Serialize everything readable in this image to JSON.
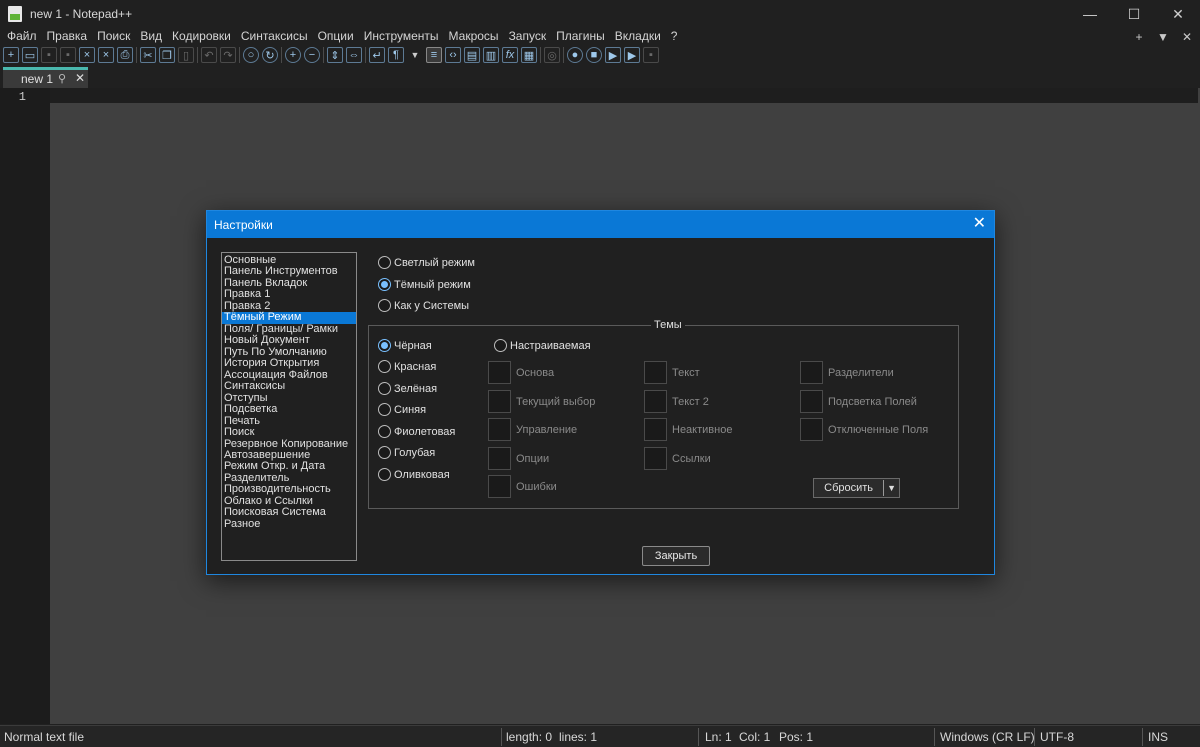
{
  "window": {
    "title": "new 1 - Notepad++",
    "controls": [
      "—",
      "☐",
      "✕"
    ]
  },
  "menu": {
    "items": [
      "Файл",
      "Правка",
      "Поиск",
      "Вид",
      "Кодировки",
      "Синтаксисы",
      "Опции",
      "Инструменты",
      "Макросы",
      "Запуск",
      "Плагины",
      "Вкладки",
      "?"
    ],
    "right": [
      "+",
      "▼",
      "✕"
    ]
  },
  "toolbar": {
    "icons": [
      "new-file-icon",
      "open-file-icon",
      "save-icon",
      "save-all-icon",
      "close-icon",
      "close-all-icon",
      "print-icon",
      "cut-icon",
      "copy-icon",
      "paste-icon",
      "undo-icon",
      "redo-icon",
      "find-icon",
      "replace-icon",
      "zoom-in-icon",
      "zoom-out-icon",
      "sync-vertical-icon",
      "sync-horizontal-icon",
      "word-wrap-icon",
      "show-all-chars-icon",
      "dropdown-icon",
      "indent-guide-icon",
      "language-icon",
      "doc-map-icon",
      "doc-list-icon",
      "function-list-icon",
      "folder-workspace-icon",
      "monitoring-icon",
      "record-macro-icon",
      "stop-macro-icon",
      "play-macro-icon",
      "run-macro-multiple-icon",
      "save-macro-icon"
    ]
  },
  "tab": {
    "label": "new 1"
  },
  "editor": {
    "line_number": "1"
  },
  "status": {
    "file_type": "Normal text file",
    "length": "length: 0",
    "lines": "lines: 1",
    "ln": "Ln: 1",
    "col": "Col: 1",
    "pos": "Pos: 1",
    "eol": "Windows (CR LF)",
    "encoding": "UTF-8",
    "mode": "INS"
  },
  "dialog": {
    "title": "Настройки",
    "categories": [
      "Основные",
      "Панель Инструментов",
      "Панель Вкладок",
      "Правка 1",
      "Правка 2",
      "Тёмный Режим",
      "Поля/ Границы/ Рамки",
      "Новый Документ",
      "Путь По Умолчанию",
      "История Открытия",
      "Ассоциация Файлов",
      "Синтаксисы",
      "Отступы",
      "Подсветка",
      "Печать",
      "Поиск",
      "Резервное Копирование",
      "Автозавершение",
      "Режим Откр. и Дата",
      "Разделитель",
      "Производительность",
      "Облако и Ссылки",
      "Поисковая Система",
      "Разное"
    ],
    "selected_category": "Тёмный Режим",
    "modes": [
      {
        "label": "Светлый режим",
        "checked": false
      },
      {
        "label": "Тёмный режим",
        "checked": true
      },
      {
        "label": "Как у Системы",
        "checked": false
      }
    ],
    "themes_label": "Темы",
    "themes": [
      {
        "label": "Чёрная",
        "checked": true
      },
      {
        "label": "Красная",
        "checked": false
      },
      {
        "label": "Зелёная",
        "checked": false
      },
      {
        "label": "Синяя",
        "checked": false
      },
      {
        "label": "Фиолетовая",
        "checked": false
      },
      {
        "label": "Голубая",
        "checked": false
      },
      {
        "label": "Оливковая",
        "checked": false
      }
    ],
    "custom_label": "Настраиваемая",
    "color_col1": [
      "Основа",
      "Текущий выбор",
      "Управление",
      "Опции",
      "Ошибки"
    ],
    "color_col2": [
      "Текст",
      "Текст 2",
      "Неактивное",
      "Ссылки"
    ],
    "color_col3": [
      "Разделители",
      "Подсветка Полей",
      "Отключенные Поля"
    ],
    "reset_label": "Сбросить",
    "close_label": "Закрыть"
  }
}
